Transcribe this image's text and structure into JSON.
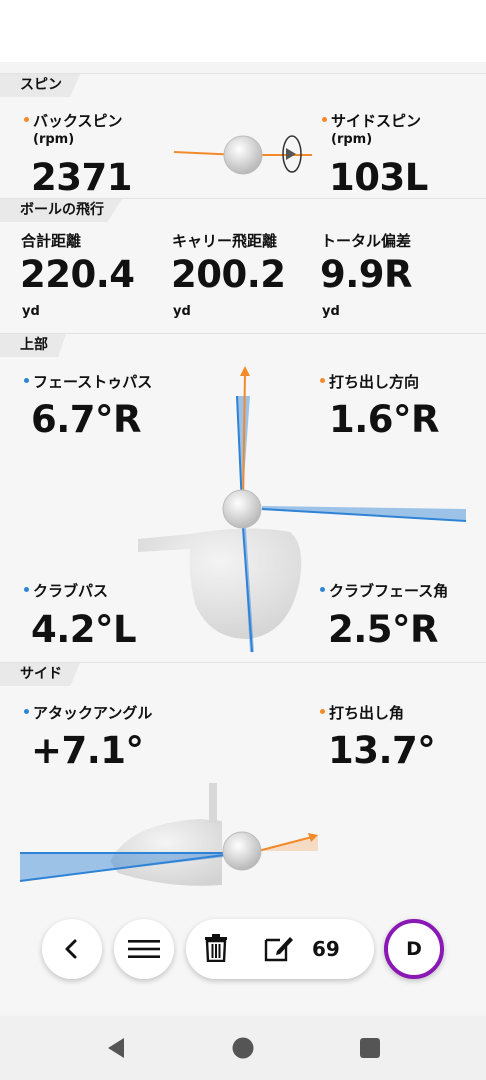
{
  "spin": {
    "tag": "スピン",
    "backspin_label": "バックスピン",
    "backspin_unit": "(rpm)",
    "backspin_value": "2371",
    "sidespin_label": "サイドスピン",
    "sidespin_unit": "(rpm)",
    "sidespin_value": "103L"
  },
  "flight": {
    "tag": "ボールの飛行",
    "total_label": "合計距離",
    "total_value": "220.4",
    "total_unit": "yd",
    "carry_label": "キャリー飛距離",
    "carry_value": "200.2",
    "carry_unit": "yd",
    "deviation_label": "トータル偏差",
    "deviation_value": "9.9R",
    "deviation_unit": "yd"
  },
  "top": {
    "tag": "上部",
    "face_to_path_label": "フェーストゥパス",
    "face_to_path_value": "6.7°R",
    "launch_direction_label": "打ち出し方向",
    "launch_direction_value": "1.6°R",
    "club_path_label": "クラブパス",
    "club_path_value": "4.2°L",
    "club_face_label": "クラブフェース角",
    "club_face_value": "2.5°R"
  },
  "side": {
    "tag": "サイド",
    "attack_angle_label": "アタックアングル",
    "attack_angle_value": "+7.1°",
    "launch_angle_label": "打ち出し角",
    "launch_angle_value": "13.7°"
  },
  "toolbar": {
    "shot_count": "69",
    "club_letter": "D"
  },
  "colors": {
    "orange": "#f28a2a",
    "blue": "#2f83d6",
    "accent_purple": "#8a18b5"
  },
  "icons": [
    "back-chevron-icon",
    "menu-icon",
    "trash-icon",
    "edit-icon",
    "nav-back-icon",
    "nav-home-icon",
    "nav-recents-icon"
  ]
}
